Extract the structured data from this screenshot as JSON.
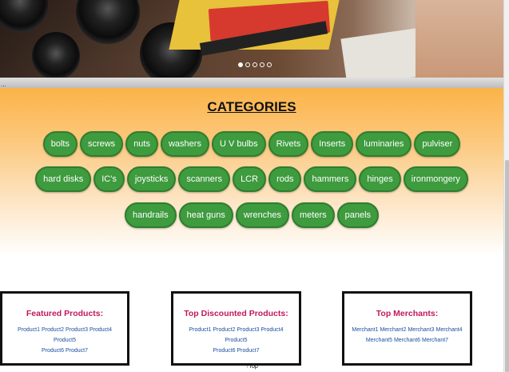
{
  "slider": {
    "dots": [
      {
        "active": true
      },
      {
        "active": false
      },
      {
        "active": false
      },
      {
        "active": false
      },
      {
        "active": false
      }
    ],
    "strip_text": "..."
  },
  "categories": {
    "title": "CATEGORIES",
    "rows": [
      [
        "bolts",
        "screws",
        "nuts",
        "washers",
        "U V bulbs",
        "Rivets",
        "Inserts",
        "luminaries",
        "pulviser"
      ],
      [
        "hard disks",
        "IC's",
        "joysticks",
        "scanners",
        "LCR",
        "rods",
        "hammers",
        "hinges",
        "ironmongery"
      ],
      [
        "handrails",
        "heat guns",
        "wrenches",
        "meters",
        "panels"
      ]
    ],
    "pill_color": "#3e9b3e"
  },
  "featured": {
    "title": "Featured Products:",
    "links": [
      "Product1",
      "Product2",
      "Product3",
      "Product4",
      "Product5",
      "Product6",
      "Product7"
    ]
  },
  "discounted": {
    "title": "Top Discounted Products:",
    "links": [
      "Product1",
      "Product2",
      "Product3",
      "Product4",
      "Product5",
      "Product6",
      "Product7"
    ]
  },
  "merchants": {
    "title": "Top Merchants:",
    "links": [
      "Merchant1",
      "Merchant2",
      "Merchant3",
      "Merchant4",
      "Merchant5",
      "Merchant6",
      "Merchant7"
    ]
  },
  "footer": {
    "to_top": "Top"
  },
  "colors": {
    "accent_title": "#c2185b",
    "link": "#1a4fa0",
    "header_orange": "#fbb348"
  }
}
